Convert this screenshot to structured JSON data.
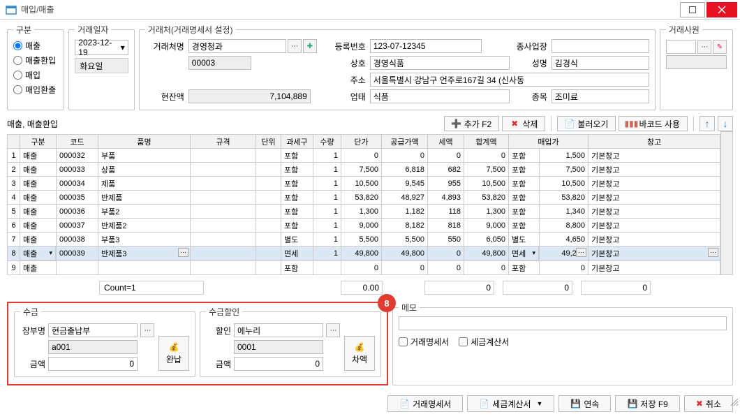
{
  "window": {
    "title": "매입/매출"
  },
  "type_group": {
    "legend": "구분",
    "options": [
      {
        "label": "매출",
        "checked": true
      },
      {
        "label": "매출환입",
        "checked": false
      },
      {
        "label": "매입",
        "checked": false
      },
      {
        "label": "매입환출",
        "checked": false
      }
    ]
  },
  "date_group": {
    "legend": "거래일자",
    "date": "2023-12-19",
    "day": "화요일"
  },
  "partner": {
    "legend": "거래처(거래명세서 설정)",
    "name_label": "거래처명",
    "name": "경영청과",
    "code": "00003",
    "regno_label": "등록번호",
    "regno": "123-07-12345",
    "corp_label": "상호",
    "corp": "경영식품",
    "biz_label": "종사업장",
    "biz": "",
    "ceo_label": "성명",
    "ceo": "김경식",
    "addr_label": "주소",
    "addr": "서울특별시 강남구 언주로167길 34 (신사동",
    "balance_label": "현잔액",
    "balance": "7,104,889",
    "type_label": "업태",
    "type": "식품",
    "kind_label": "종목",
    "kind": "조미료"
  },
  "staff": {
    "legend": "거래사원"
  },
  "grid_label": "매출, 매출환입",
  "toolbar": {
    "add": "추가 F2",
    "delete": "삭제",
    "import": "불러오기",
    "barcode": "바코드 사용"
  },
  "grid": {
    "headers": [
      "",
      "구분",
      "코드",
      "품명",
      "규격",
      "단위",
      "과세구",
      "수량",
      "단가",
      "공급가액",
      "세액",
      "합계액",
      "매입가",
      "",
      "창고"
    ],
    "rows": [
      {
        "no": "1",
        "gubun": "매출",
        "code": "000032",
        "name": "부품",
        "spec": "",
        "unit": "",
        "tax": "포함",
        "qty": "1",
        "price": "0",
        "supply": "0",
        "vat": "0",
        "total": "0",
        "ptax": "포함",
        "pprice": "1,500",
        "wh": "기본창고",
        "sel": false
      },
      {
        "no": "2",
        "gubun": "매출",
        "code": "000033",
        "name": "상품",
        "spec": "",
        "unit": "",
        "tax": "포함",
        "qty": "1",
        "price": "7,500",
        "supply": "6,818",
        "vat": "682",
        "total": "7,500",
        "ptax": "포함",
        "pprice": "7,500",
        "wh": "기본창고",
        "sel": false
      },
      {
        "no": "3",
        "gubun": "매출",
        "code": "000034",
        "name": "제품",
        "spec": "",
        "unit": "",
        "tax": "포함",
        "qty": "1",
        "price": "10,500",
        "supply": "9,545",
        "vat": "955",
        "total": "10,500",
        "ptax": "포함",
        "pprice": "10,500",
        "wh": "기본창고",
        "sel": false
      },
      {
        "no": "4",
        "gubun": "매출",
        "code": "000035",
        "name": "반제품",
        "spec": "",
        "unit": "",
        "tax": "포함",
        "qty": "1",
        "price": "53,820",
        "supply": "48,927",
        "vat": "4,893",
        "total": "53,820",
        "ptax": "포함",
        "pprice": "53,820",
        "wh": "기본창고",
        "sel": false
      },
      {
        "no": "5",
        "gubun": "매출",
        "code": "000036",
        "name": "부품2",
        "spec": "",
        "unit": "",
        "tax": "포함",
        "qty": "1",
        "price": "1,300",
        "supply": "1,182",
        "vat": "118",
        "total": "1,300",
        "ptax": "포함",
        "pprice": "1,340",
        "wh": "기본창고",
        "sel": false
      },
      {
        "no": "6",
        "gubun": "매출",
        "code": "000037",
        "name": "반제품2",
        "spec": "",
        "unit": "",
        "tax": "포함",
        "qty": "1",
        "price": "9,000",
        "supply": "8,182",
        "vat": "818",
        "total": "9,000",
        "ptax": "포함",
        "pprice": "8,800",
        "wh": "기본창고",
        "sel": false
      },
      {
        "no": "7",
        "gubun": "매출",
        "code": "000038",
        "name": "부품3",
        "spec": "",
        "unit": "",
        "tax": "별도",
        "qty": "1",
        "price": "5,500",
        "supply": "5,500",
        "vat": "550",
        "total": "6,050",
        "ptax": "별도",
        "pprice": "4,650",
        "wh": "기본창고",
        "sel": false
      },
      {
        "no": "8",
        "gubun": "매출",
        "code": "000039",
        "name": "반제품3",
        "spec": "",
        "unit": "",
        "tax": "면세",
        "qty": "1",
        "price": "49,800",
        "supply": "49,800",
        "vat": "0",
        "total": "49,800",
        "ptax": "면세",
        "pprice": "49,210",
        "wh": "기본창고",
        "sel": true
      },
      {
        "no": "9",
        "gubun": "매출",
        "code": "",
        "name": "",
        "spec": "",
        "unit": "",
        "tax": "포함",
        "qty": "",
        "price": "0",
        "supply": "0",
        "vat": "0",
        "total": "0",
        "ptax": "포함",
        "pprice": "0",
        "wh": "기본창고",
        "sel": false
      }
    ],
    "count_label": "Count=1",
    "totals": {
      "qty": "0.00",
      "supply": "0",
      "vat": "0",
      "total": "0"
    }
  },
  "collect": {
    "legend": "수금",
    "book_label": "장부명",
    "book": "현금출납부",
    "book_code": "a001",
    "amount_label": "금액",
    "amount": "0",
    "pay_btn": "완납"
  },
  "discount": {
    "legend": "수금할인",
    "disc_label": "할인",
    "disc": "에누리",
    "disc_code": "0001",
    "amount_label": "금액",
    "amount": "0",
    "diff_btn": "차액"
  },
  "memo": {
    "legend": "메모",
    "value": "",
    "chk1": "거래명세서",
    "chk2": "세금계산서"
  },
  "footer": {
    "stmt": "거래명세서",
    "tax": "세금계산서",
    "cont": "연속",
    "save": "저장 F9",
    "cancel": "취소"
  },
  "badge": "8"
}
